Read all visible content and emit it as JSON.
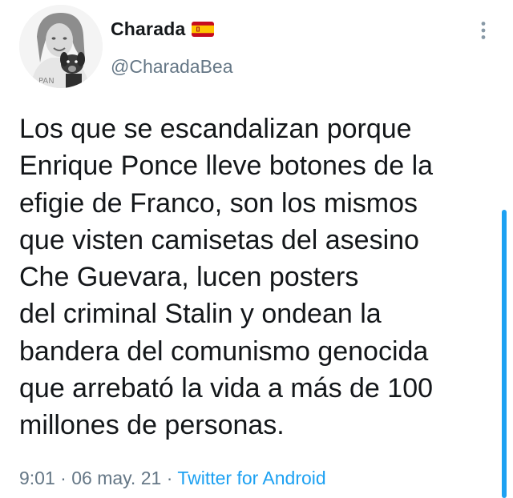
{
  "author": {
    "display_name": "Charada",
    "flag_icon": "spain-flag-icon",
    "handle": "@CharadaBea",
    "avatar_icon": "profile-avatar-with-dog"
  },
  "tweet": {
    "lines": [
      "Los que se escandalizan porque",
      "Enrique Ponce lleve botones de la",
      "efigie de Franco, son los mismos",
      "que visten camisetas del asesino",
      "Che Guevara, lucen posters",
      "del criminal Stalin y ondean la",
      "bandera del comunismo genocida",
      "que arrebató la vida a más de 100",
      "millones de personas."
    ]
  },
  "meta": {
    "time": "9:01",
    "separator": " · ",
    "date": "06 may. 21",
    "source": "Twitter for Android"
  },
  "colors": {
    "text": "#14171a",
    "secondary": "#657786",
    "accent": "#1da1f2"
  },
  "menu": {
    "more_icon": "vertical-dots-icon"
  }
}
